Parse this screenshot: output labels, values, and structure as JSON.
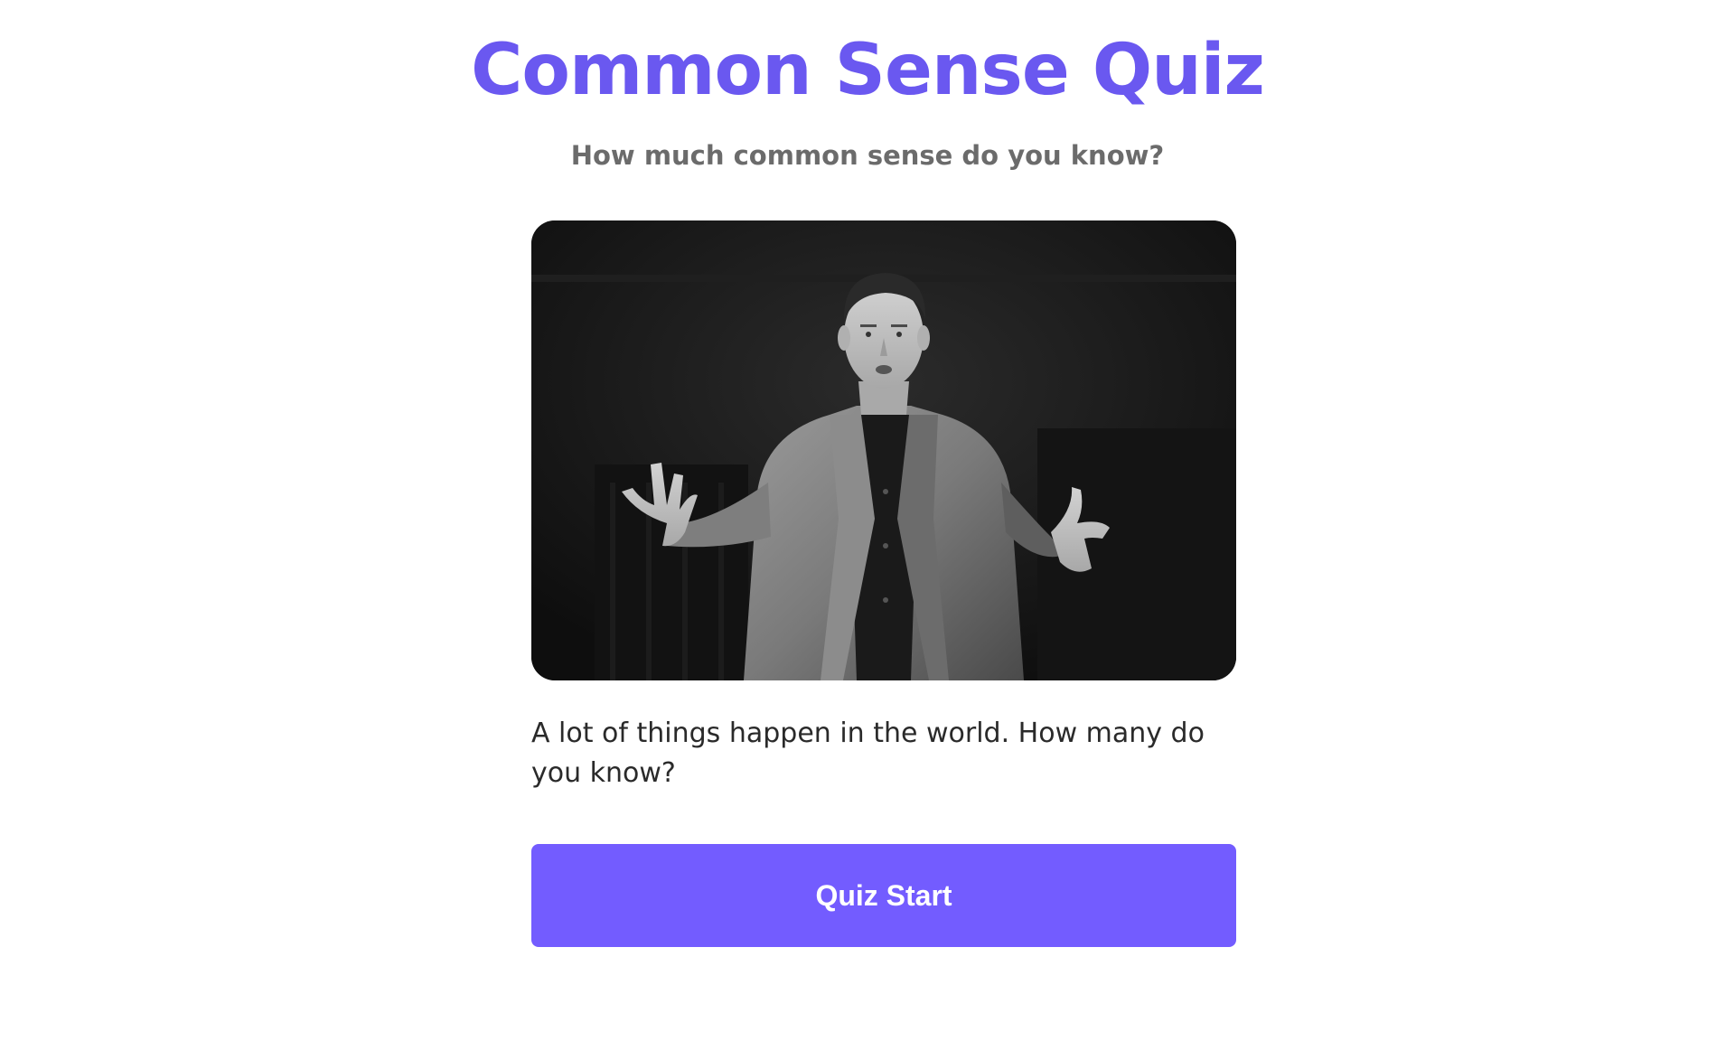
{
  "header": {
    "title": "Common Sense Quiz",
    "subtitle": "How much common sense do you know?"
  },
  "hero": {
    "image_subject": "speaker-photo"
  },
  "main": {
    "description": "A lot of things happen in the world. How many do you know?",
    "start_button_label": "Quiz Start"
  },
  "colors": {
    "accent": "#735CFF",
    "title": "#6A58F0",
    "subtitle": "#6B6B6B",
    "text": "#2A2A2A",
    "background": "#FFFFFF"
  }
}
